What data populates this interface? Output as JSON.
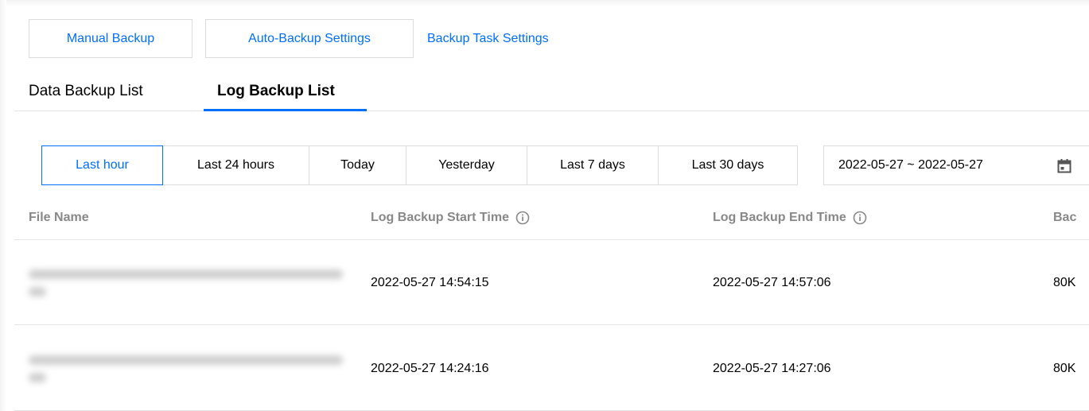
{
  "actions": {
    "manual_backup": "Manual Backup",
    "auto_backup_settings": "Auto-Backup Settings",
    "backup_task_settings": "Backup Task Settings"
  },
  "tabs": [
    {
      "label": "Data Backup List",
      "active": false
    },
    {
      "label": "Log Backup List",
      "active": true
    }
  ],
  "time_filter": {
    "options": [
      "Last hour",
      "Last 24 hours",
      "Today",
      "Yesterday",
      "Last 7 days",
      "Last 30 days"
    ],
    "selected": "Last hour",
    "date_range": "2022-05-27 ~ 2022-05-27",
    "date_icon": "calendar-icon"
  },
  "table": {
    "columns": [
      "File Name",
      "Log Backup Start Time",
      "Log Backup End Time",
      "Bac"
    ],
    "info_icon": "info-icon",
    "rows": [
      {
        "file_name": "",
        "start_time": "2022-05-27 14:54:15",
        "end_time": "2022-05-27 14:57:06",
        "size": "80K"
      },
      {
        "file_name": "",
        "start_time": "2022-05-27 14:24:16",
        "end_time": "2022-05-27 14:27:06",
        "size": "80K"
      }
    ]
  },
  "colors": {
    "accent": "#006eff",
    "border": "#dcdcdc",
    "header_text": "#888888"
  }
}
